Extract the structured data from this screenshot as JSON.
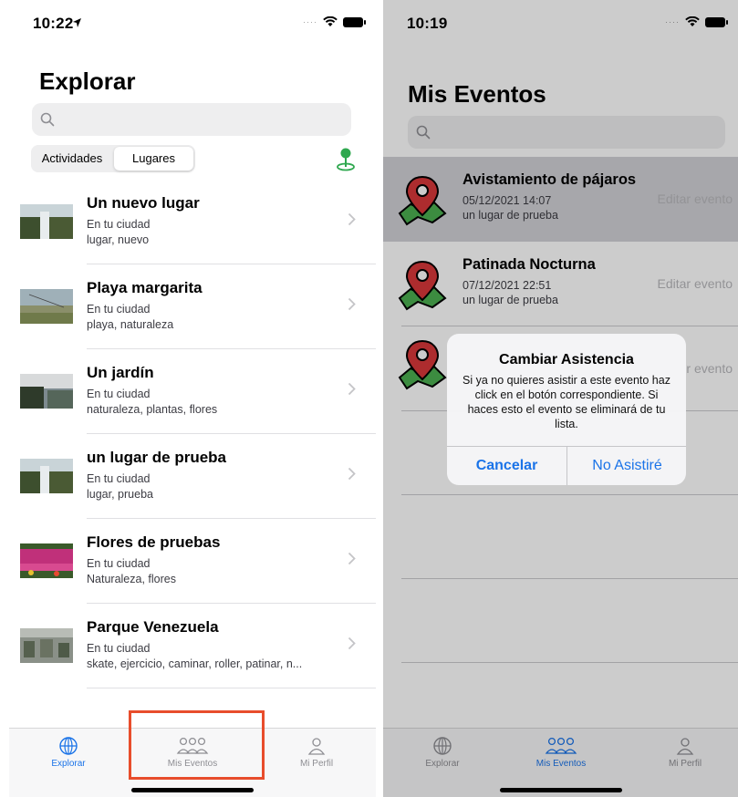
{
  "left": {
    "status_time": "10:22",
    "title": "Explorar",
    "segments": [
      "Actividades",
      "Lugares"
    ],
    "selected_segment": "Lugares",
    "places": [
      {
        "name": "Un nuevo lugar",
        "location": "En tu ciudad",
        "tags": "lugar, nuevo"
      },
      {
        "name": "Playa margarita",
        "location": "En tu ciudad",
        "tags": "playa, naturaleza"
      },
      {
        "name": "Un jardín",
        "location": "En tu ciudad",
        "tags": "naturaleza, plantas, flores"
      },
      {
        "name": "un lugar de prueba",
        "location": "En tu ciudad",
        "tags": "lugar, prueba"
      },
      {
        "name": "Flores de pruebas",
        "location": "En tu ciudad",
        "tags": "Naturaleza, flores"
      },
      {
        "name": "Parque Venezuela",
        "location": "En tu ciudad",
        "tags": "skate, ejercicio, caminar, roller, patinar, n..."
      }
    ],
    "tabs": [
      "Explorar",
      "Mis Eventos",
      "Mi Perfil"
    ],
    "active_tab": "Explorar"
  },
  "right": {
    "status_time": "10:19",
    "title": "Mis Eventos",
    "events": [
      {
        "title": "Avistamiento de pájaros",
        "date": "05/12/2021 14:07",
        "place": "un lugar de prueba",
        "action": "Editar evento"
      },
      {
        "title": "Patinada Nocturna",
        "date": "07/12/2021 22:51",
        "place": "un lugar de prueba",
        "action": "Editar evento"
      },
      {
        "action_partial": "r evento"
      }
    ],
    "alert": {
      "title": "Cambiar Asistencia",
      "message": "Si ya no quieres asistir a este evento haz click en el botón correspondiente. Si haces esto el evento se eliminará de tu lista.",
      "cancel": "Cancelar",
      "confirm": "No Asistiré"
    },
    "tabs": [
      "Explorar",
      "Mis Eventos",
      "Mi Perfil"
    ],
    "active_tab": "Mis Eventos"
  },
  "colors": {
    "accent": "#1a73e8",
    "highlight": "#e84d2c",
    "pin_green": "#2fa84f",
    "pin_red": "#d9383a"
  }
}
